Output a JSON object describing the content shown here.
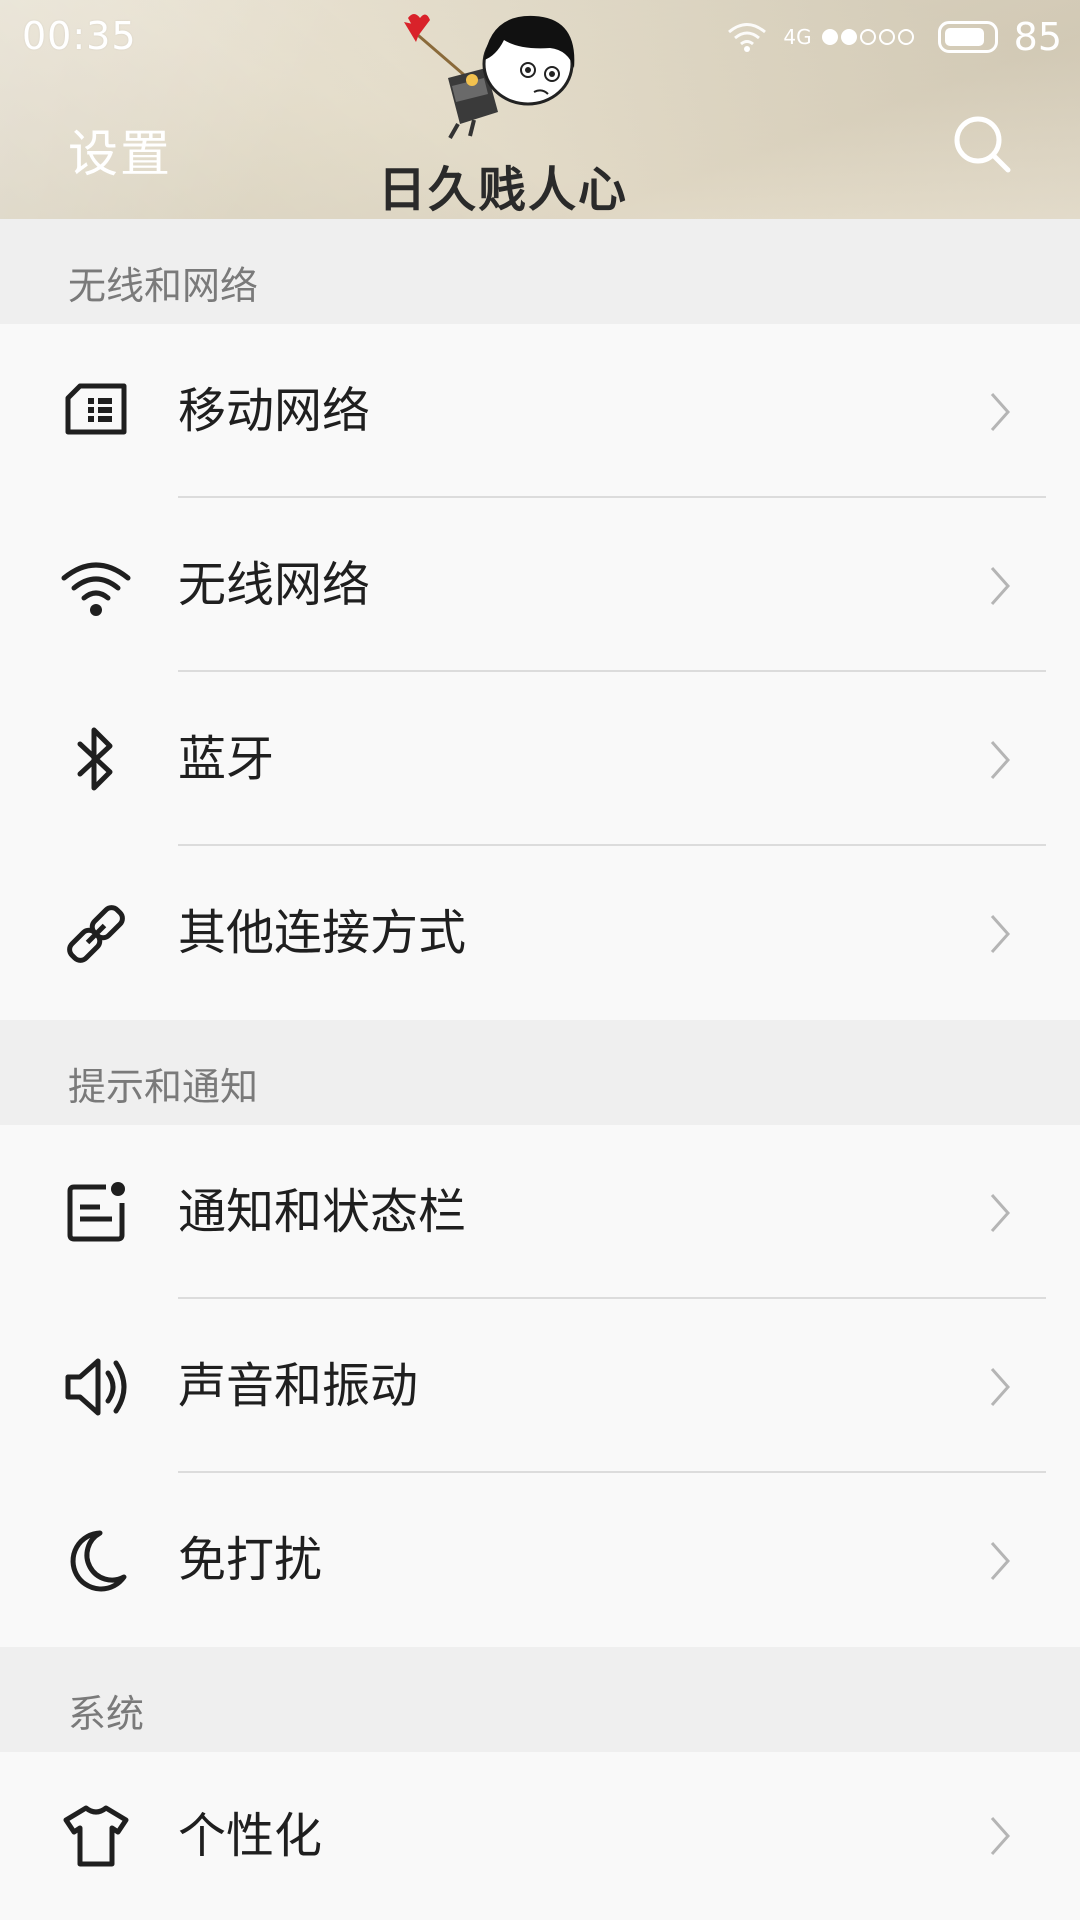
{
  "status_bar": {
    "time": "00:35",
    "network": "4G",
    "battery": "85",
    "signal_level": 2,
    "signal_total": 5
  },
  "header": {
    "title": "设置",
    "mascot_caption": "日久贱人心",
    "search_icon": "search-icon"
  },
  "sections": [
    {
      "title": "无线和网络",
      "items": [
        {
          "label": "移动网络",
          "icon": "sim-card-icon"
        },
        {
          "label": "无线网络",
          "icon": "wifi-icon"
        },
        {
          "label": "蓝牙",
          "icon": "bluetooth-icon"
        },
        {
          "label": "其他连接方式",
          "icon": "link-icon"
        }
      ]
    },
    {
      "title": "提示和通知",
      "items": [
        {
          "label": "通知和状态栏",
          "icon": "notification-icon"
        },
        {
          "label": "声音和振动",
          "icon": "speaker-icon"
        },
        {
          "label": "免打扰",
          "icon": "moon-icon"
        }
      ]
    },
    {
      "title": "系统",
      "items": [
        {
          "label": "个性化",
          "icon": "tshirt-icon"
        }
      ]
    }
  ],
  "colors": {
    "header_bg": "#e4dcc8",
    "section_bg": "#efefef",
    "row_bg": "#f9f9f9",
    "divider": "#dcdcdc",
    "chevron": "#b5b5b5"
  }
}
